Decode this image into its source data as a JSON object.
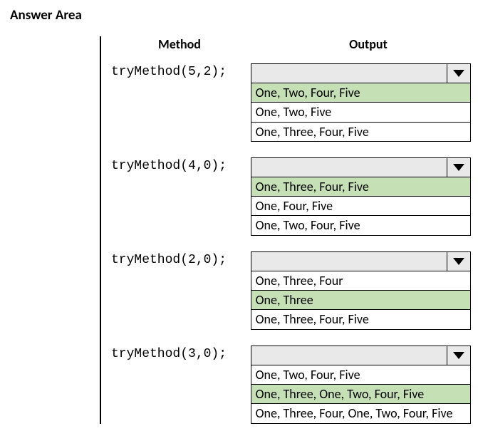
{
  "title": "Answer Area",
  "headers": {
    "method": "Method",
    "output": "Output"
  },
  "rows": [
    {
      "method": "tryMethod(5,2);",
      "options": [
        {
          "text": "One, Two, Four, Five",
          "highlighted": true
        },
        {
          "text": "One, Two, Five",
          "highlighted": false
        },
        {
          "text": "One, Three, Four, Five",
          "highlighted": false
        }
      ]
    },
    {
      "method": "tryMethod(4,0);",
      "options": [
        {
          "text": "One, Three, Four, Five",
          "highlighted": true
        },
        {
          "text": "One, Four, Five",
          "highlighted": false
        },
        {
          "text": "One, Two, Four, Five",
          "highlighted": false
        }
      ]
    },
    {
      "method": "tryMethod(2,0);",
      "options": [
        {
          "text": "One, Three, Four",
          "highlighted": false
        },
        {
          "text": "One, Three",
          "highlighted": true
        },
        {
          "text": "One, Three, Four, Five",
          "highlighted": false
        }
      ]
    },
    {
      "method": "tryMethod(3,0);",
      "options": [
        {
          "text": "One, Two, Four, Five",
          "highlighted": false
        },
        {
          "text": "One, Three, One, Two, Four, Five",
          "highlighted": true
        },
        {
          "text": "One, Three, Four, One, Two, Four, Five",
          "highlighted": false
        }
      ]
    }
  ]
}
